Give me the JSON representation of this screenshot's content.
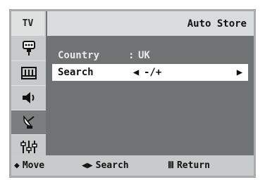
{
  "header": {
    "tab": "TV",
    "title": "Auto Store"
  },
  "sidebar": {
    "items": [
      {
        "icon": "input-icon"
      },
      {
        "icon": "picture-icon"
      },
      {
        "icon": "sound-icon"
      },
      {
        "icon": "channel-icon",
        "active": true
      },
      {
        "icon": "setup-icon"
      }
    ]
  },
  "menu": {
    "country": {
      "label": "Country",
      "separator": ":",
      "value": "UK"
    },
    "search": {
      "label": "Search",
      "left_arrow": "◀",
      "value": "-/+",
      "right_arrow": "▶"
    }
  },
  "footer": {
    "move": {
      "glyph": "◆",
      "label": "Move"
    },
    "search": {
      "glyph": "◀▶",
      "label": "Search"
    },
    "return": {
      "glyph": "Ⅲ",
      "label": "Return"
    }
  }
}
